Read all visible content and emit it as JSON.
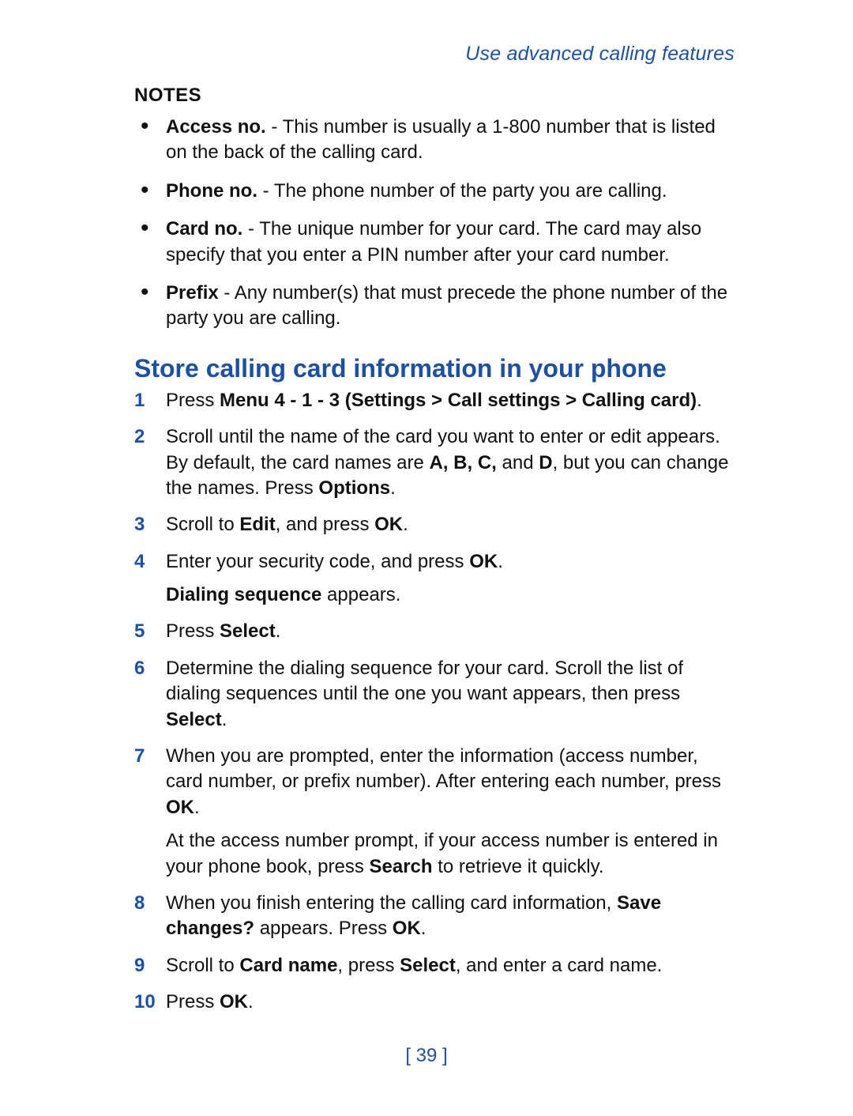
{
  "running_head": "Use advanced calling features",
  "notes": {
    "label": "NOTES",
    "items": [
      {
        "term": "Access no.",
        "text": " - This number is usually a 1-800 number that is listed on the back of the calling card."
      },
      {
        "term": "Phone no.",
        "text": " - The phone number of the party you are calling."
      },
      {
        "term": "Card no.",
        "text": " - The unique number for your card. The card may also specify that you enter a PIN number after your card number."
      },
      {
        "term": "Prefix",
        "text": " - Any number(s) that must precede the phone number of the party you are calling."
      }
    ]
  },
  "section_title": "Store calling card information in your phone",
  "steps": {
    "s1": {
      "num": "1",
      "pre": "Press ",
      "bold": "Menu 4 - 1 - 3 (Settings > Call settings > Calling card)",
      "post": "."
    },
    "s2": {
      "num": "2",
      "t1": "Scroll until the name of the card you want to enter or edit appears. By default, the card names are ",
      "b_abcd": "A, B, C,",
      "t2": " and ",
      "b_d": "D",
      "t3": ", but you can change the names. Press ",
      "b_opt": "Options",
      "t4": "."
    },
    "s3": {
      "num": "3",
      "t1": "Scroll to ",
      "b_edit": "Edit",
      "t2": ", and press ",
      "b_ok": "OK",
      "t3": "."
    },
    "s4": {
      "num": "4",
      "t1": "Enter your security code, and press ",
      "b_ok": "OK",
      "t2": ".",
      "p2_b": "Dialing sequence",
      "p2_t": " appears."
    },
    "s5": {
      "num": "5",
      "t1": "Press ",
      "b_sel": "Select",
      "t2": "."
    },
    "s6": {
      "num": "6",
      "t1": "Determine the dialing sequence for your card. Scroll the list of dialing sequences until the one you want appears, then press ",
      "b_sel": "Select",
      "t2": "."
    },
    "s7": {
      "num": "7",
      "t1": "When you are prompted, enter the information (access number, card number, or prefix number). After entering each number, press ",
      "b_ok": "OK",
      "t2": ".",
      "p2a": "At the access number prompt, if your access number is entered in your phone book, press ",
      "p2b": "Search",
      "p2c": " to retrieve it quickly."
    },
    "s8": {
      "num": "8",
      "t1": "When you finish entering the calling card information, ",
      "b_save": "Save changes?",
      "t2": " appears. Press ",
      "b_ok": "OK",
      "t3": "."
    },
    "s9": {
      "num": "9",
      "t1": "Scroll to ",
      "b_card": "Card name",
      "t2": ", press ",
      "b_sel": "Select",
      "t3": ", and enter a card name."
    },
    "s10": {
      "num": "10",
      "t1": "Press ",
      "b_ok": "OK",
      "t2": "."
    }
  },
  "page_number": "[ 39 ]"
}
